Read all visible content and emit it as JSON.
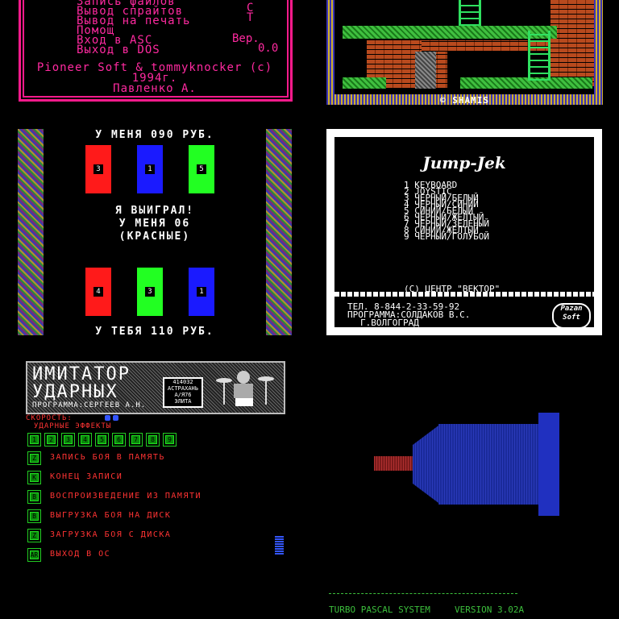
{
  "menu_tile": {
    "items": [
      "Запись файлов",
      "Вывод спрайтов",
      "Вывод на печать",
      "Помощ",
      "Вход в ASC",
      "Выход в DOS"
    ],
    "keys": [
      "C",
      "T"
    ],
    "version_label": "Вер.",
    "version_value": "0.0",
    "credit_line1": "Pioneer Soft & tommyknocker (c)",
    "credit_line2": "1994г.",
    "credit_line3": "Павленко А."
  },
  "platform_tile": {
    "signature": "© SHAMIS"
  },
  "card_tile": {
    "my_money": "У МЕНЯ 090 РУБ.",
    "win_line1": "Я ВЫИГРАЛ!",
    "win_line2": "У МЕНЯ 06",
    "win_line3": "(КРАСНЫЕ)",
    "your_money": "У ТЕБЯ 110 РУБ.",
    "top_cards": [
      {
        "color": "#ff1a1a",
        "num": "3"
      },
      {
        "color": "#1a1aff",
        "num": "1"
      },
      {
        "color": "#22ff22",
        "num": "5"
      }
    ],
    "bottom_cards": [
      {
        "color": "#ff1a1a",
        "num": "4"
      },
      {
        "color": "#22ff22",
        "num": "3"
      },
      {
        "color": "#1a1aff",
        "num": "1"
      }
    ]
  },
  "jump_tile": {
    "title": "Jump-Jek",
    "options": [
      "1 KEYBOARD",
      "2 JOYSTIC",
      "3 ЧЕРНЫЙ/БЕЛЫЙ",
      "4 ЧЕРНЫЙ/СИНИЙ",
      "5 СИНИЙ/БЕЛЫЙ",
      "6 ЧЕРНЫЙ/ЖЕЛТЫЙ",
      "7 ЧЕРНЫЙ/ЗЕЛЕНЫЙ",
      "8 СИНИЙ/ЖЕЛТЫЙ",
      "9 ЧЕРНЫЙ/ГОЛУБОЙ"
    ],
    "copyright": "(С) ЦЕНТР \"ВЕКТОР\"",
    "phone": "ТЕЛ. 8-844-2-33-59-92",
    "author": "ПРОГРАММА:СОЛДАКОВ В.С.",
    "city": "Г.ВОЛГОГРАД",
    "logo": "Pazan Soft"
  },
  "drum_tile": {
    "title1": "ИМИТАТОР",
    "title2": "УДАРНЫХ",
    "author": "ПРОГРАММА:СЕРГЕЕВ А.Н.",
    "stamp": "414032 АСТРАХАНЬ А/Я76 ЭЛИТА",
    "speed_label": "СКОРОСТЬ:",
    "effects_label": "УДАРНЫЕ ЭФФЕКТЫ",
    "effect_buttons": [
      "1",
      "2",
      "3",
      "4",
      "5",
      "6",
      "7",
      "8",
      "9"
    ],
    "menu": [
      {
        "key": "Z",
        "label": "ЗАПИСЬ БОЯ В ПАМЯТЬ"
      },
      {
        "key": "K",
        "label": "КОНЕЦ ЗАПИСИ"
      },
      {
        "key": "B",
        "label": "ВОСПРОИЗВЕДЕНИЕ ИЗ ПАМЯТИ"
      },
      {
        "key": "B",
        "label": "ВЫГРУЗКА БОЯ НА ДИСК"
      },
      {
        "key": "Z",
        "label": "ЗАГРУЗКА БОЯ С ДИСКА"
      },
      {
        "key": "AR",
        "label": "ВЫХОД В ОС"
      }
    ]
  },
  "pascal_tile": {
    "system": "TURBO PASCAL SYSTEM",
    "version": "VERSION 3.02A"
  }
}
